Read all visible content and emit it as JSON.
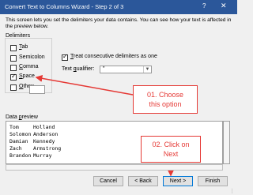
{
  "window": {
    "title": "Convert Text to Columns Wizard - Step 2 of 3",
    "help_label": "?",
    "close_label": "✕"
  },
  "description": "This screen lets you set the delimiters your data contains. You can see how your text is affected in the preview below.",
  "delimiters": {
    "heading": "Delimiters",
    "options": [
      {
        "first": "T",
        "rest": "ab",
        "checked": false
      },
      {
        "first": "Se",
        "rest": "micolon",
        "checked": false
      },
      {
        "first": "C",
        "rest": "omma",
        "checked": false
      },
      {
        "first": "S",
        "rest": "pace",
        "checked": true
      },
      {
        "first": "O",
        "rest": "ther:",
        "checked": false
      }
    ]
  },
  "consecutive": {
    "first": "T",
    "rest": "reat consecutive delimiters as one",
    "checked": true
  },
  "qualifier": {
    "label_first": "Text ",
    "label_u": "q",
    "label_rest": "ualifier:",
    "value": "\""
  },
  "callouts": {
    "one_line1": "01. Choose",
    "one_line2": "this option",
    "two_line1": "02. Click on",
    "two_line2": "Next"
  },
  "preview": {
    "label_first": "Data ",
    "label_u": "p",
    "label_rest": "review",
    "rows": [
      [
        "Tom",
        "Holland"
      ],
      [
        "Solomon",
        "Anderson"
      ],
      [
        "Damian",
        "Kennedy"
      ],
      [
        "Zach",
        "Armstrong"
      ],
      [
        "Brandon",
        "Murray"
      ]
    ]
  },
  "buttons": {
    "cancel": "Cancel",
    "back": "< Back",
    "next": "Next >",
    "finish": "Finish"
  },
  "colors": {
    "accent": "#e53935",
    "titlebar": "#2b579a"
  }
}
